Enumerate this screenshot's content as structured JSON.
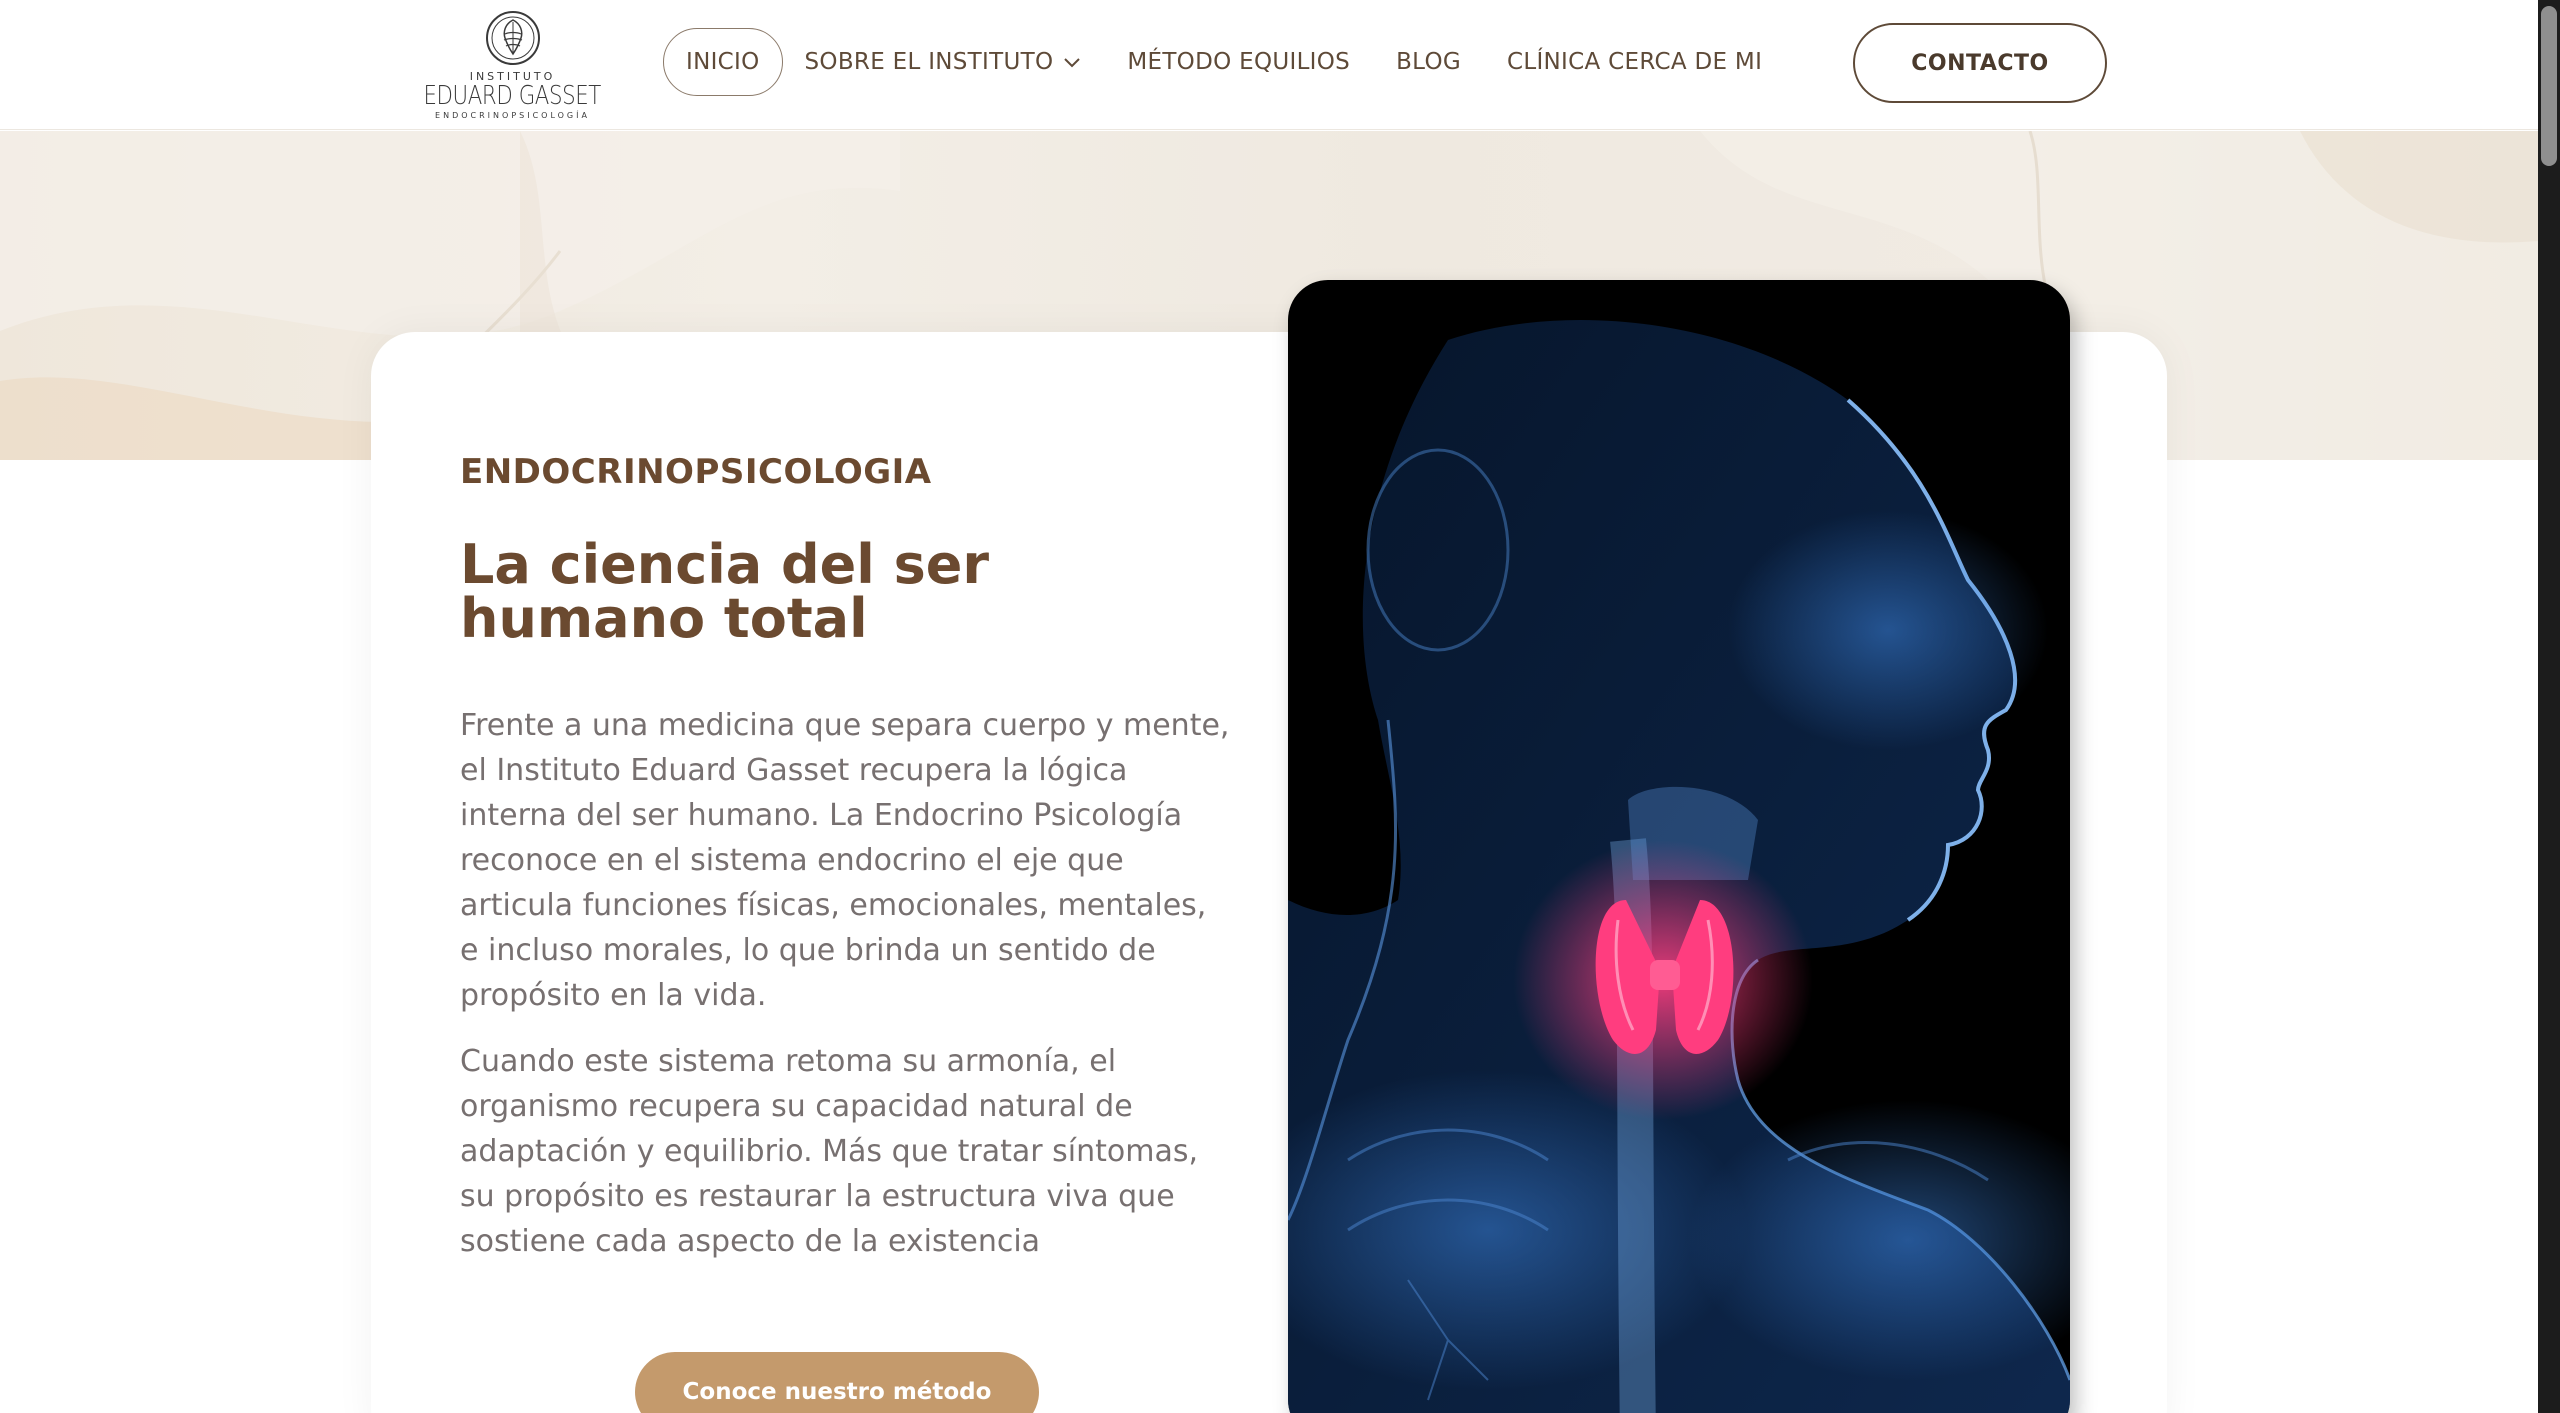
{
  "logo": {
    "line1": "INSTITUTO",
    "line2": "EDUARD GASSET",
    "line3": "ENDOCRINOPSICOLOGÍA"
  },
  "nav": {
    "items": [
      {
        "label": "INICIO",
        "active": true
      },
      {
        "label": "SOBRE EL INSTITUTO",
        "has_dropdown": true
      },
      {
        "label": "MÉTODO EQUILIOS"
      },
      {
        "label": "BLOG"
      },
      {
        "label": "CLÍNICA CERCA DE MI"
      }
    ],
    "contact_label": "CONTACTO"
  },
  "hero": {
    "eyebrow": "ENDOCRINOPSICOLOGIA",
    "title": "La ciencia del ser humano total",
    "paragraph1": "Frente a una medicina que separa cuerpo y mente, el Instituto Eduard Gasset recupera la lógica interna del ser humano. La Endocrino Psicología reconoce en el sistema endocrino el eje que articula funciones físicas, emocionales, mentales, e incluso morales, lo que brinda un sentido de propósito en la vida.",
    "paragraph2": "Cuando este sistema retoma su armonía, el organismo recupera su capacidad natural de adaptación y equilibrio. Más que tratar síntomas, su propósito es restaurar la estructura viva que sostiene cada aspecto de la existencia",
    "cta_label": "Conoce nuestro método"
  },
  "colors": {
    "brand_brown": "#6b4a30",
    "cta_gold": "#c49a6c",
    "thyroid_pink": "#ff3d7f",
    "xray_blue": "#3a7fd6"
  }
}
